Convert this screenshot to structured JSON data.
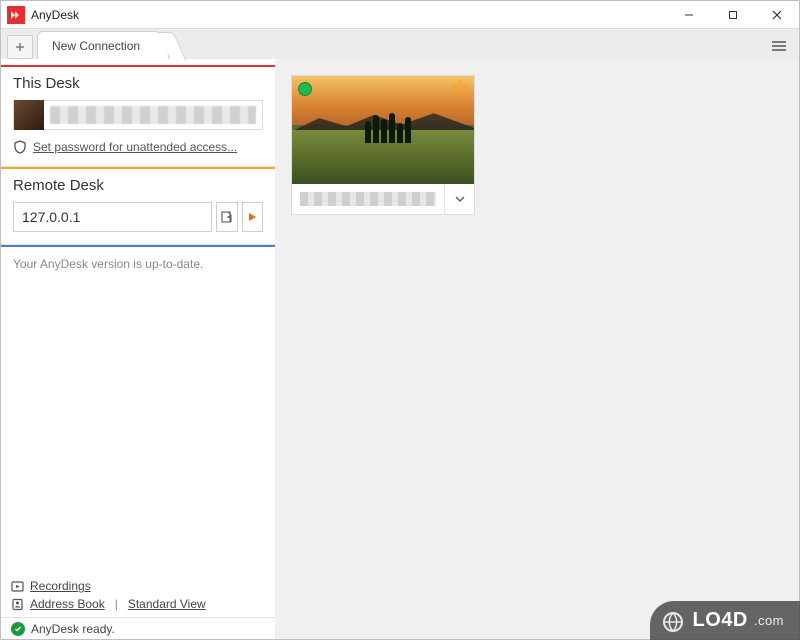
{
  "app": {
    "title": "AnyDesk"
  },
  "tabs": {
    "main_label": "New Connection"
  },
  "this_desk": {
    "heading": "This Desk",
    "unattended_link": "Set password for unattended access..."
  },
  "remote_desk": {
    "heading": "Remote Desk",
    "address_value": "127.0.0.1"
  },
  "update": {
    "message": "Your AnyDesk version is up-to-date."
  },
  "bottom": {
    "recordings": "Recordings",
    "address_book": "Address Book",
    "standard_view": "Standard View"
  },
  "status": {
    "text": "AnyDesk ready."
  },
  "watermark": {
    "brand": "LO4D",
    "tld": ".com"
  }
}
